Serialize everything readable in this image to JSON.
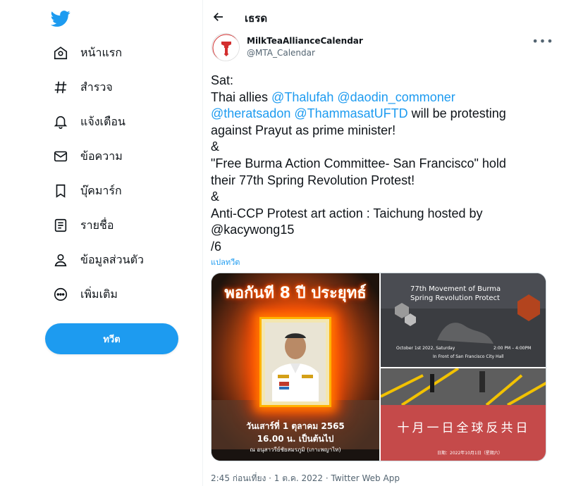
{
  "sidebar": {
    "items": [
      {
        "label": "หน้าแรก",
        "icon": "home-icon"
      },
      {
        "label": "สำรวจ",
        "icon": "hashtag-icon"
      },
      {
        "label": "แจ้งเตือน",
        "icon": "bell-icon"
      },
      {
        "label": "ข้อความ",
        "icon": "mail-icon"
      },
      {
        "label": "บุ๊คมาร์ก",
        "icon": "bookmark-icon"
      },
      {
        "label": "รายชื่อ",
        "icon": "list-icon"
      },
      {
        "label": "ข้อมูลส่วนตัว",
        "icon": "profile-icon"
      },
      {
        "label": "เพิ่มเติม",
        "icon": "more-circle-icon"
      }
    ],
    "tweet_button": "ทวีต"
  },
  "header": {
    "title": "เธรด"
  },
  "tweet": {
    "display_name": "MilkTeaAllianceCalendar",
    "handle": "@MTA_Calendar",
    "line1": "Sat:",
    "line2_pre": "Thai allies ",
    "mention1": "@Thalufah",
    "mention2": "@daodin_commoner",
    "mention3": "@theratsadon",
    "mention4": "@ThammasatUFTD",
    "line3_post": " will be protesting",
    "line4": "against Prayut as prime minister!",
    "line5": "&",
    "line6": "\"Free Burma Action Committee- San Francisco\" hold",
    "line7": "their 77th Spring Revolution Protest!",
    "line8": "&",
    "line9": "Anti-CCP Protest art action : Taichung hosted by",
    "line10": "@kacywong15",
    "line11": "/6",
    "translate": "แปลทวีต",
    "meta": "2:45 ก่อนเที่ยง · 1 ต.ค. 2022 · Twitter Web App"
  },
  "media": {
    "m1_title": "พอกันที 8 ปี ประยุทธ์",
    "m1_date": "วันเสาร์ที่ 1 ตุลาคม 2565",
    "m1_time": "16.00 น. เป็นต้นไป",
    "m1_place": "ณ อนุสาวรีย์ชัยสมรภูมิ (เกาะพญาไท)",
    "m2_title_1": "77th Movement of Burma",
    "m2_title_2": "Spring Revolution Protect",
    "m2_date": "October 1st 2022, Saturday",
    "m2_time": "2:00 PM – 4:00PM",
    "m2_place": "In Front of San Francisco City Hall",
    "m3_title": "十月一日全球反共日",
    "m3_small": "日期：2022年10月1日（星期六）"
  },
  "colors": {
    "accent": "#1d9bf0",
    "text": "#0f1419",
    "muted": "#536471"
  }
}
